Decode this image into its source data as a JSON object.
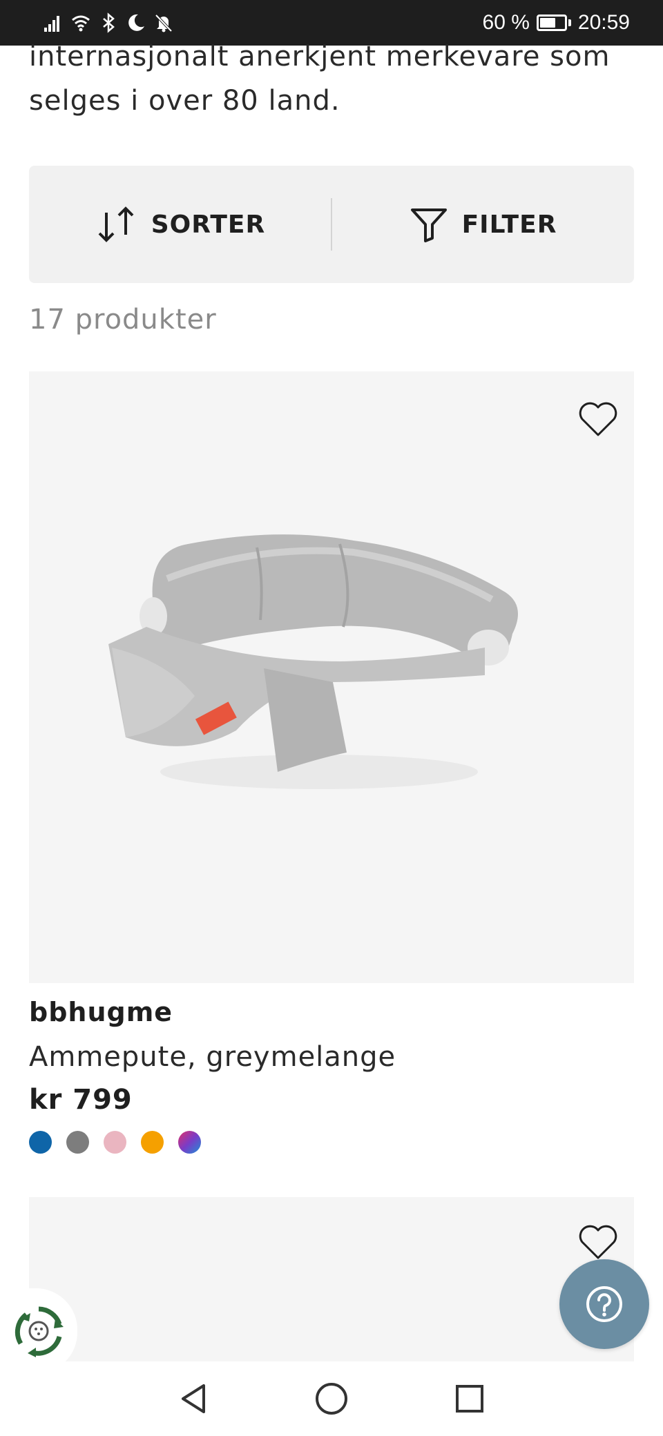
{
  "status_bar": {
    "battery_percent": "60 %",
    "time": "20:59",
    "battery_level": 0.6,
    "icons": [
      "signal-icon",
      "wifi-icon",
      "bluetooth-icon",
      "moon-icon",
      "mute-bell-icon",
      "battery-icon"
    ]
  },
  "intro": {
    "line1": "internasjonalt anerkjent merkevare som",
    "line2": "selges i over 80 land."
  },
  "toolbar": {
    "sort_label": "SORTER",
    "filter_label": "FILTER",
    "sort_icon": "sort-arrows-icon",
    "filter_icon": "funnel-icon"
  },
  "results": {
    "count_text": "17 produkter"
  },
  "products": [
    {
      "brand": "bbhugme",
      "name": "Ammepute, greymelange",
      "price": "kr 799",
      "swatch_colors": [
        "#0f65a8",
        "#7d7d7d",
        "#eab5c0",
        "#f5a000",
        "gradient"
      ],
      "favorite_icon": "heart-outline-icon",
      "image": "grey-nursing-pillow"
    },
    {
      "favorite_icon": "heart-outline-icon"
    }
  ],
  "floating": {
    "eco_icon": "recycle-badge-icon",
    "help_icon": "question-mark-icon"
  },
  "nav_bar": {
    "icons": [
      "back-triangle-icon",
      "home-circle-icon",
      "recents-square-icon"
    ]
  },
  "colors": {
    "help_button": "#6b8ea3",
    "card_background": "#f5f5f5",
    "toolbar_background": "#f1f1f1",
    "eco_green": "#2e6b3a"
  }
}
